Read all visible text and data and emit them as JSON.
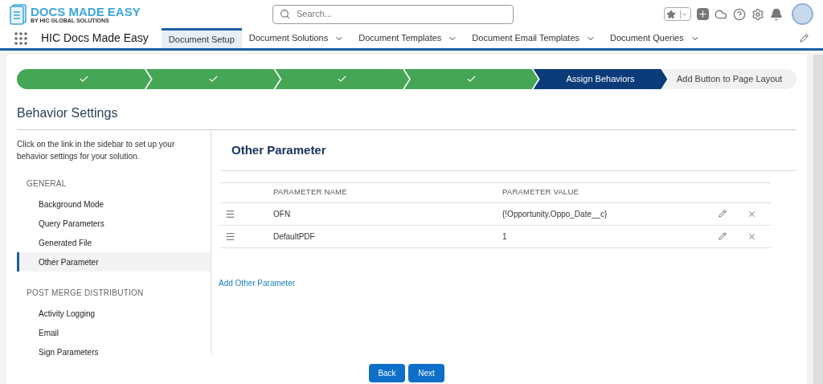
{
  "header": {
    "logo_title": "DOCS MADE EASY",
    "logo_subtitle": "BY HIC GLOBAL SOLUTIONS",
    "search": {
      "placeholder": "Search..."
    }
  },
  "nav": {
    "app_name": "HIC Docs Made Easy",
    "tabs": [
      {
        "label": "Document Setup",
        "selected": true,
        "dropdown": false
      },
      {
        "label": "Document Solutions",
        "selected": false,
        "dropdown": true
      },
      {
        "label": "Document Templates",
        "selected": false,
        "dropdown": true
      },
      {
        "label": "Document Email Templates",
        "selected": false,
        "dropdown": true
      },
      {
        "label": "Document Queries",
        "selected": false,
        "dropdown": true
      }
    ]
  },
  "steps": [
    {
      "done": true,
      "selected": false
    },
    {
      "done": true,
      "selected": false
    },
    {
      "done": true,
      "selected": false
    },
    {
      "done": true,
      "selected": false
    },
    {
      "done": false,
      "selected": true,
      "label": "Assign Behaviors"
    },
    {
      "done": false,
      "selected": false,
      "label": "Add Button to Page Layout"
    }
  ],
  "page_title": "Behavior Settings",
  "sidebar": {
    "intro": "Click on the link in the sidebar to set up your behavior settings for your solution.",
    "groups": [
      {
        "heading": "GENERAL",
        "items": [
          {
            "label": "Background Mode",
            "selected": false
          },
          {
            "label": "Query Parameters",
            "selected": false
          },
          {
            "label": "Generated File",
            "selected": false
          },
          {
            "label": "Other Parameter",
            "selected": true
          }
        ]
      },
      {
        "heading": "POST MERGE DISTRIBUTION",
        "items": [
          {
            "label": "Activity Logging",
            "selected": false
          },
          {
            "label": "Email",
            "selected": false
          },
          {
            "label": "Sign Parameters",
            "selected": false
          }
        ]
      }
    ]
  },
  "panel": {
    "title": "Other Parameter",
    "table": {
      "columns": [
        "PARAMETER NAME",
        "PARAMETER VALUE"
      ],
      "rows": [
        {
          "name": "OFN",
          "value": "{!Opportunity.Oppo_Date__c}"
        },
        {
          "name": "DefaultPDF",
          "value": "1"
        }
      ]
    },
    "add_link": "Add Other Parameter"
  },
  "buttons": [
    "Back",
    "Next"
  ]
}
